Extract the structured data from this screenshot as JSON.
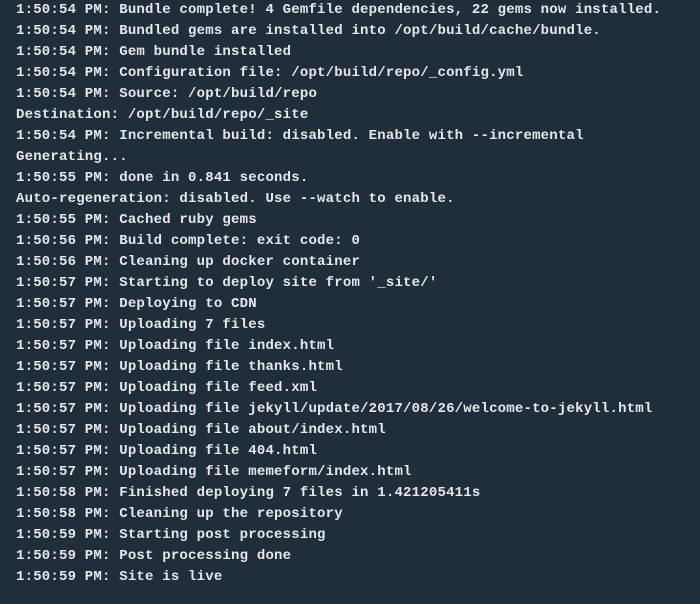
{
  "log_lines": [
    "1:50:54 PM: Bundle complete! 4 Gemfile dependencies, 22 gems now installed.",
    "1:50:54 PM: Bundled gems are installed into /opt/build/cache/bundle.",
    "1:50:54 PM: Gem bundle installed",
    "1:50:54 PM: Configuration file: /opt/build/repo/_config.yml",
    "1:50:54 PM: Source: /opt/build/repo",
    "Destination: /opt/build/repo/_site",
    "1:50:54 PM: Incremental build: disabled. Enable with --incremental",
    "Generating...",
    "1:50:55 PM: done in 0.841 seconds.",
    "Auto-regeneration: disabled. Use --watch to enable.",
    "1:50:55 PM: Cached ruby gems",
    "1:50:56 PM: Build complete: exit code: 0",
    "1:50:56 PM: Cleaning up docker container",
    "1:50:57 PM: Starting to deploy site from '_site/'",
    "1:50:57 PM: Deploying to CDN",
    "1:50:57 PM: Uploading 7 files",
    "1:50:57 PM: Uploading file index.html",
    "1:50:57 PM: Uploading file thanks.html",
    "1:50:57 PM: Uploading file feed.xml",
    "1:50:57 PM: Uploading file jekyll/update/2017/08/26/welcome-to-jekyll.html",
    "1:50:57 PM: Uploading file about/index.html",
    "1:50:57 PM: Uploading file 404.html",
    "1:50:57 PM: Uploading file memeform/index.html",
    "1:50:58 PM: Finished deploying 7 files in 1.421205411s",
    "1:50:58 PM: Cleaning up the repository",
    "1:50:59 PM: Starting post processing",
    "1:50:59 PM: Post processing done",
    "1:50:59 PM: Site is live"
  ]
}
